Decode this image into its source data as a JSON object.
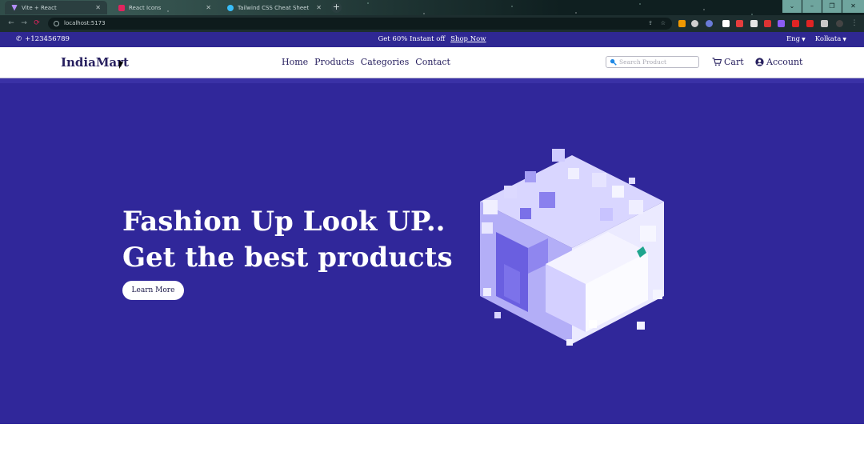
{
  "browser": {
    "tabs": [
      {
        "title": "Vite + React",
        "favicon_color": "#b28cf5"
      },
      {
        "title": "React Icons",
        "favicon_color": "#e0245e"
      },
      {
        "title": "Tailwind CSS Cheat Sheet",
        "favicon_color": "#38bdf8"
      }
    ],
    "url": "localhost:5173",
    "new_tab_symbol": "+",
    "window_controls": [
      "⌄",
      "–",
      "❐",
      "✕"
    ]
  },
  "promo": {
    "phone": "+123456789",
    "offer_text": "Get 60% Instant off",
    "offer_link": "Shop Now",
    "language": "Eng",
    "location": "Kolkata"
  },
  "navbar": {
    "logo": "IndiaMart",
    "menu": [
      "Home",
      "Products",
      "Categories",
      "Contact"
    ],
    "search_placeholder": "Search Product",
    "cart_label": "Cart",
    "account_label": "Account"
  },
  "hero": {
    "headline_line1": "Fashion Up Look UP..",
    "headline_line2": "Get the best products",
    "cta_label": "Learn More"
  },
  "colors": {
    "brand_dark": "#27205f",
    "promo_bg": "#2f2893",
    "hero_bg": "#30279a",
    "cube_light": "#e7e6ff",
    "cube_mid": "#a7a2f5"
  }
}
